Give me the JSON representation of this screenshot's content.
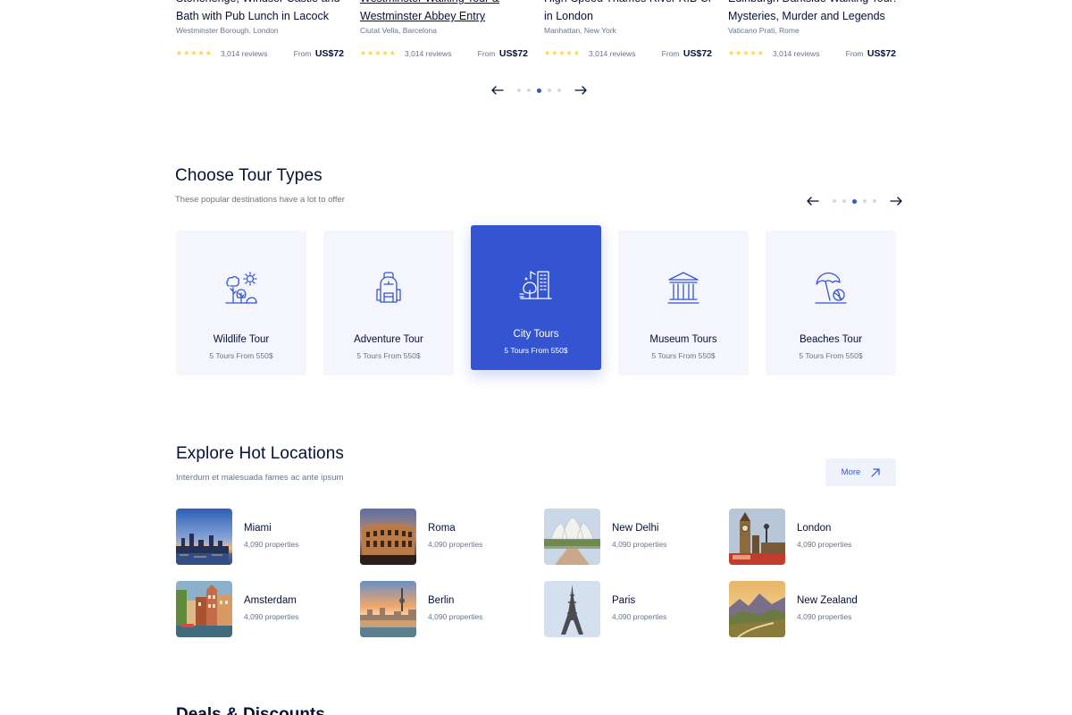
{
  "tours": [
    {
      "title_lines": [
        "Stonehenge, Windsor Castle and",
        "Bath with Pub Lunch in Lacock"
      ],
      "location": "Westminster Borough, London",
      "reviews": "3,014 reviews",
      "price_prefix": "From",
      "price": "US$72",
      "underline": false
    },
    {
      "title_lines": [
        "Westminster Walking Tour &",
        "Westminster Abbey Entry"
      ],
      "location": "Ciutat Vella, Barcelona",
      "reviews": "3,014 reviews",
      "price_prefix": "From",
      "price": "US$72",
      "underline": true
    },
    {
      "title_lines": [
        "High-Speed Thames River RIB Cruise",
        "in London"
      ],
      "location": "Manhattan, New York",
      "reviews": "3,014 reviews",
      "price_prefix": "From",
      "price": "US$72",
      "underline": false
    },
    {
      "title_lines": [
        "Edinburgh Darkside Walking Tour:",
        "Mysteries, Murder and Legends"
      ],
      "location": "Vaticano Prati, Rome",
      "reviews": "3,014 reviews",
      "price_prefix": "From",
      "price": "US$72",
      "underline": false
    }
  ],
  "rating_stars": "★★★★★",
  "pager_top": {
    "dots": 5,
    "active": 2
  },
  "tour_types": {
    "title": "Choose Tour Types",
    "subtitle": "These popular destinations have a lot to offer",
    "pager": {
      "dots": 5,
      "active": 2
    },
    "items": [
      {
        "name": "Wildlife Tour",
        "count": "5  Tours From 550$",
        "icon": "wildlife-icon",
        "active": false
      },
      {
        "name": "Adventure Tour",
        "count": "5  Tours From 550$",
        "icon": "backpack-icon",
        "active": false
      },
      {
        "name": "City Tours",
        "count": "5  Tours From 550$",
        "icon": "city-icon",
        "active": true
      },
      {
        "name": "Museum Tours",
        "count": "5  Tours From 550$",
        "icon": "museum-icon",
        "active": false
      },
      {
        "name": "Beaches Tour",
        "count": "5  Tours From 550$",
        "icon": "beach-umbrella-icon",
        "active": false
      }
    ]
  },
  "locations": {
    "title": "Explore Hot Locations",
    "subtitle": "Interdum et malesuada fames ac ante ipsum",
    "more_label": "More",
    "items": [
      {
        "name": "Miami",
        "count": "4,090 properties"
      },
      {
        "name": "Roma",
        "count": "4,090 properties"
      },
      {
        "name": "New Delhi",
        "count": "4,090 properties"
      },
      {
        "name": "London",
        "count": "4,090 properties"
      },
      {
        "name": "Amsterdam",
        "count": "4,090 properties"
      },
      {
        "name": "Berlin",
        "count": "4,090 properties"
      },
      {
        "name": "Paris",
        "count": "4,090 properties"
      },
      {
        "name": "New Zealand",
        "count": "4,090 properties"
      }
    ]
  },
  "next_section_title": "Deals & Discounts",
  "colors": {
    "accent": "#3554d1",
    "text": "#051036",
    "muted": "#697488",
    "tile_bg": "#f5f6fd",
    "star": "#f8d448"
  }
}
